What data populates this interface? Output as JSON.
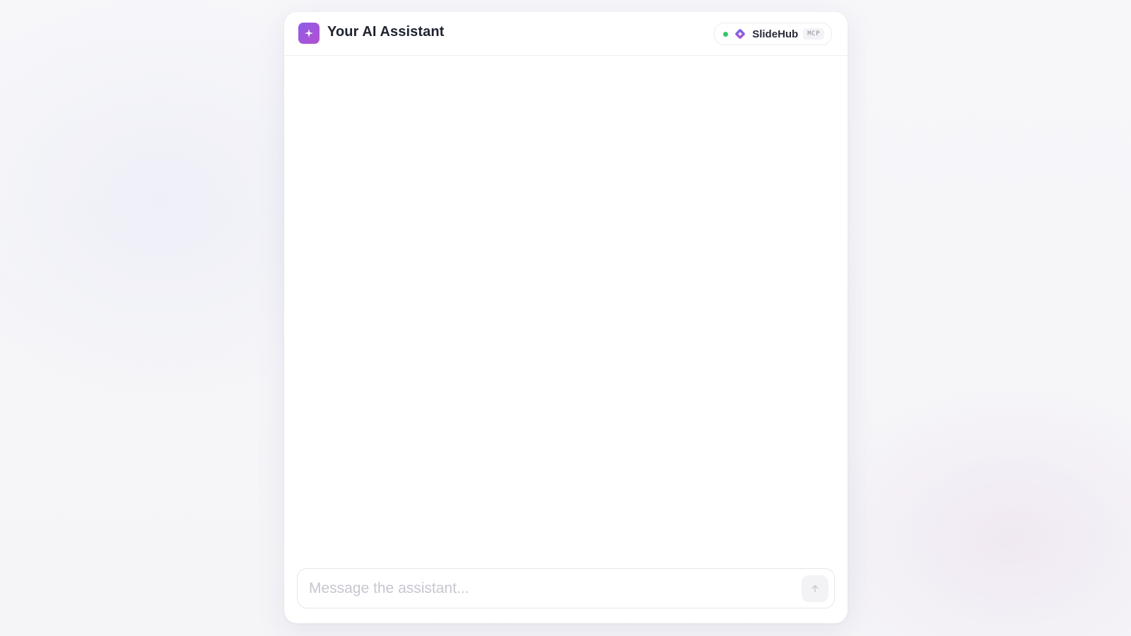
{
  "header": {
    "title": "Your AI Assistant",
    "logo_icon": "sparkle-icon",
    "accent_gradient": [
      "#8e5ee8",
      "#b24fcf"
    ]
  },
  "integration": {
    "status": "connected",
    "status_color": "#34c76a",
    "brand_icon": "slidehub-diamond-icon",
    "name": "SlideHub",
    "badge": "MCP"
  },
  "composer": {
    "placeholder": "Message the assistant...",
    "value": "",
    "send_icon": "arrow-up-icon"
  }
}
